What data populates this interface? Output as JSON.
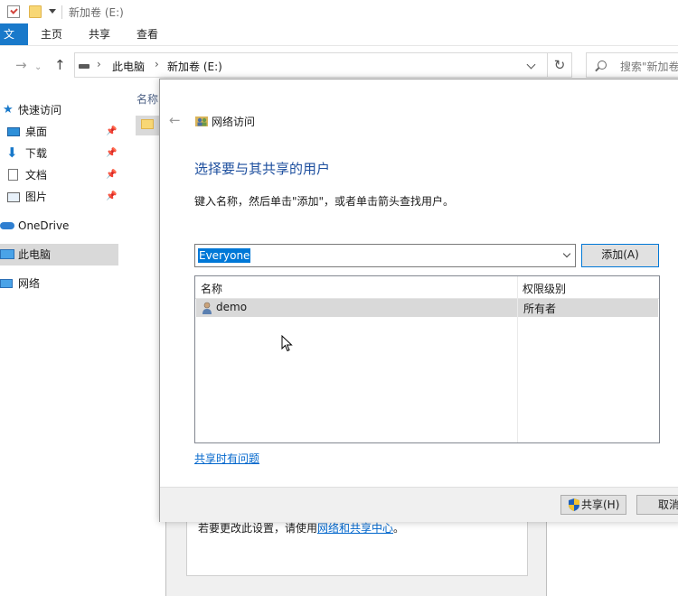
{
  "explorer": {
    "title": "新加卷 (E:)",
    "ribbon_tabs": [
      "文件",
      "主页",
      "共享",
      "查看"
    ],
    "breadcrumbs": [
      "此电脑",
      "新加卷 (E:)"
    ],
    "search_placeholder": "搜索\"新加卷",
    "column_header": "名称",
    "sidebar": [
      {
        "label": "快速访问",
        "icon": "star-icon"
      },
      {
        "label": "桌面",
        "icon": "desktop-icon",
        "pinned": true
      },
      {
        "label": "下载",
        "icon": "download-icon",
        "pinned": true
      },
      {
        "label": "文档",
        "icon": "document-icon",
        "pinned": true
      },
      {
        "label": "图片",
        "icon": "picture-icon",
        "pinned": true
      },
      {
        "label": "OneDrive",
        "icon": "cloud-icon"
      },
      {
        "label": "此电脑",
        "icon": "computer-icon",
        "selected": true
      },
      {
        "label": "网络",
        "icon": "network-icon"
      }
    ]
  },
  "background_window": {
    "text_prefix": "若要更改此设置，请使用",
    "link": "网络和共享中心",
    "text_suffix": "。"
  },
  "dialog": {
    "title": "网络访问",
    "heading": "选择要与其共享的用户",
    "instruction": "键入名称，然后单击\"添加\"，或者单击箭头查找用户。",
    "combo_value": "Everyone",
    "add_button": "添加(A)",
    "columns": [
      "名称",
      "权限级别"
    ],
    "rows": [
      {
        "name": "demo",
        "permission": "所有者"
      }
    ],
    "help_link": "共享时有问题",
    "share_button": "共享(H)",
    "cancel_button": "取消"
  },
  "colors": {
    "accent": "#0078d7",
    "file_tab": "#1979ca",
    "heading": "#1c4e9e",
    "link": "#0066cc",
    "selection": "#d9d9d9"
  }
}
